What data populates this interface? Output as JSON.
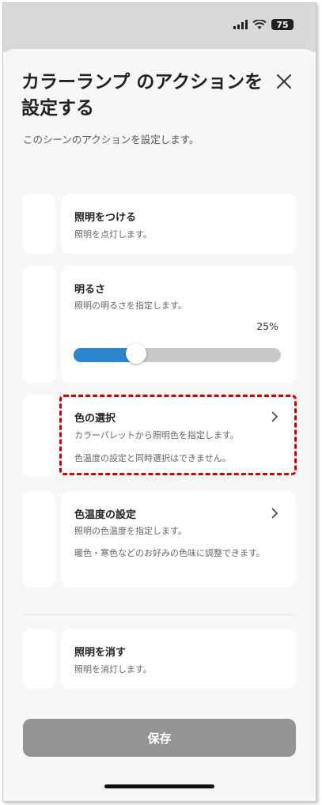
{
  "status_bar": {
    "battery": "75"
  },
  "header": {
    "title": "カラーランプ のアクションを設定する",
    "subtitle": "このシーンのアクションを設定します。"
  },
  "actions": {
    "light_on": {
      "title": "照明をつける",
      "desc": "照明を点灯します。"
    },
    "brightness": {
      "title": "明るさ",
      "desc": "照明の明るさを指定します。",
      "value_label": "25%",
      "value": 0.25
    },
    "color_select": {
      "title": "色の選択",
      "desc": "カラーパレットから照明色を指定します。",
      "note": "色温度の設定と同時選択はできません。",
      "icon": "chevron-right-icon"
    },
    "color_temp": {
      "title": "色温度の設定",
      "desc": "照明の色温度を指定します。",
      "note": "暖色・寒色などのお好みの色味に調整できます。",
      "icon": "chevron-right-icon"
    },
    "light_off": {
      "title": "照明を消す",
      "desc": "照明を消灯します。"
    }
  },
  "footer": {
    "save_label": "保存"
  },
  "colors": {
    "accent": "#2e86cf",
    "highlight": "#d40000",
    "save_button": "#949494"
  }
}
